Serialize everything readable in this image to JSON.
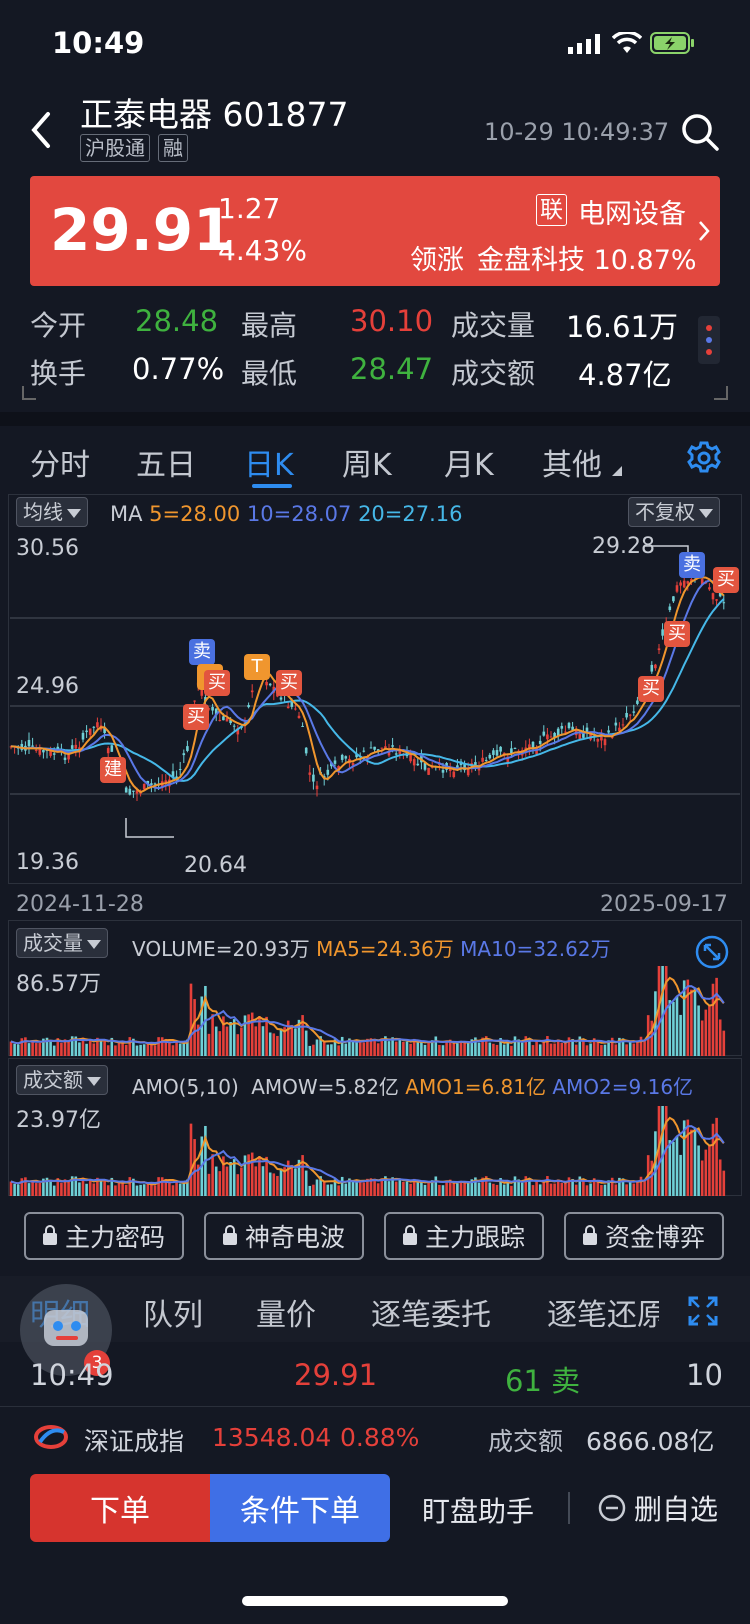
{
  "status": {
    "time": "10:49"
  },
  "header": {
    "title": "正泰电器 601877",
    "tags": [
      "沪股通",
      "融"
    ],
    "datetime": "10-29 10:49:37"
  },
  "quote": {
    "price": "29.91",
    "change": "1.27",
    "change_pct": "4.43%",
    "sector_badge": "联",
    "sector": "电网设备",
    "leader_prefix": "领涨",
    "leader": "金盘科技 10.87%"
  },
  "stats": {
    "open_label": "今开",
    "open": "28.48",
    "high_label": "最高",
    "high": "30.10",
    "vol_label": "成交量",
    "vol": "16.61万",
    "turn_label": "换手",
    "turn": "0.77%",
    "low_label": "最低",
    "low": "28.47",
    "amt_label": "成交额",
    "amt": "4.87亿"
  },
  "tabs": [
    "分时",
    "五日",
    "日K",
    "周K",
    "月K",
    "其他"
  ],
  "kline": {
    "ma_btn": "均线",
    "ma_label": "MA",
    "ma5": "5=28.00",
    "ma10": "10=28.07",
    "ma20": "20=27.16",
    "adj_btn": "不复权",
    "y_top": "30.56",
    "y_mid": "24.96",
    "y_low": "19.36",
    "hi_mark": "29.28",
    "lo_mark": "20.64",
    "date_start": "2024-11-28",
    "date_end": "2025-09-17",
    "signals": {
      "jian": "建",
      "buy": "买",
      "sell": "卖",
      "t": "T"
    }
  },
  "volume": {
    "btn": "成交量",
    "label": "VOLUME=20.93万",
    "ma5": "MA5=24.36万",
    "ma10": "MA10=32.62万",
    "ymax": "86.57万"
  },
  "amount": {
    "btn": "成交额",
    "label": "AMO(5,10)",
    "amow": "AMOW=5.82亿",
    "amo1": "AMO1=6.81亿",
    "amo2": "AMO2=9.16亿",
    "ymax": "23.97亿"
  },
  "tools": [
    "主力密码",
    "神奇电波",
    "主力跟踪",
    "资金博弈"
  ],
  "detail_tabs": [
    "明细",
    "队列",
    "量价",
    "逐笔委托",
    "逐笔还原"
  ],
  "trade": {
    "time": "10:49",
    "price": "29.91",
    "qty": "61 卖",
    "num": "10",
    "badge": "3"
  },
  "index": {
    "name": "深证成指",
    "value": "13548.04",
    "pct": "0.88%",
    "amt_label": "成交额",
    "amt": "6866.08亿"
  },
  "bottom": {
    "order": "下单",
    "cond_order": "条件下单",
    "assist": "盯盘助手",
    "del_fav": "删自选"
  },
  "colors": {
    "up": "#e5403a",
    "down": "#3fb23f",
    "accent": "#2e8cf0",
    "ma5": "#f0962e",
    "ma10": "#5a78e6",
    "ma20": "#46b8e8"
  }
}
